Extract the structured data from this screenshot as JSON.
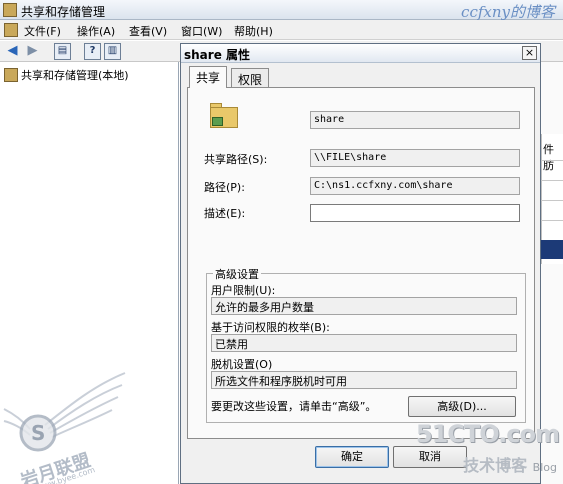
{
  "window": {
    "title": "共享和存储管理",
    "watermark_top": "ccfxny的博客"
  },
  "menu": {
    "items": [
      "文件(F)",
      "操作(A)",
      "查看(V)",
      "窗口(W)",
      "帮助(H)"
    ]
  },
  "toolbar": {
    "back_icon": "arrow-left-icon",
    "forward_icon": "arrow-right-icon",
    "help_glyph": "?"
  },
  "tree": {
    "root_label": "共享和存储管理(本地)"
  },
  "right_pane": {
    "column_header_fragment": "件肪"
  },
  "dialog": {
    "title": "share 属性",
    "close_glyph": "×",
    "tabs": [
      {
        "label": "共享",
        "active": true
      },
      {
        "label": "权限",
        "active": false
      }
    ],
    "share_name": "share",
    "share_path_label": "共享路径(S):",
    "share_path_value": "\\\\FILE\\share",
    "path_label": "路径(P):",
    "path_value": "C:\\ns1.ccfxny.com\\share",
    "description_label": "描述(E):",
    "description_value": "",
    "advanced": {
      "group_title": "高级设置",
      "user_limit_label": "用户限制(U):",
      "user_limit_value": "允许的最多用户数量",
      "abe_label": "基于访问权限的枚举(B):",
      "abe_value": "已禁用",
      "offline_label": "脱机设置(O)",
      "offline_value": "所选文件和程序脱机时可用",
      "hint_text": "要更改这些设置，请单击“高级”。",
      "advanced_button": "高级(D)..."
    },
    "ok_button": "确定",
    "cancel_button": "取消"
  },
  "watermarks": {
    "left_brand": "岩月联盟",
    "left_url": "www.byee.com",
    "right_brand": "51CTO.com",
    "right_sub": "技术博客",
    "right_sub_en": "Blog"
  }
}
